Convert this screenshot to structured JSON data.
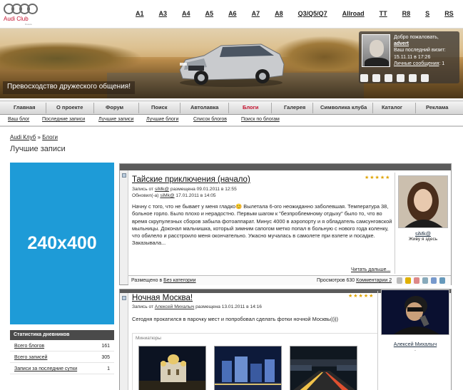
{
  "logo": {
    "club": "Audi Club",
    "sub": "Russia"
  },
  "models": [
    "A1",
    "A3",
    "A4",
    "A5",
    "A6",
    "A7",
    "A8",
    "Q3/Q5/Q7",
    "Allroad",
    "TT",
    "R8",
    "S",
    "RS"
  ],
  "banner": {
    "tagline": "Превосходство дружеского общения!"
  },
  "user": {
    "welcome": "Добро пожаловать,",
    "name": "advert",
    "last_visit_label": "Ваш последний визит:",
    "last_visit": "15.11.11 в 17:26",
    "messages_label": "Личные сообщения",
    "messages_count": ": 1",
    "icons": [
      "profile-icon",
      "pages-icon",
      "book-icon",
      "screen-icon",
      "settings-icon",
      "exit-icon"
    ]
  },
  "nav": {
    "main": [
      "Главная",
      "О проекте",
      "Форум",
      "Поиск",
      "Автолавка",
      "Блоги",
      "Галерея",
      "Символика клуба",
      "Каталог",
      "Реклама"
    ],
    "sub": [
      "Ваш блог",
      "Последние записи",
      "Лучшие записи",
      "Лучшие блоги",
      "Список блогов",
      "Поиск по блогам"
    ]
  },
  "breadcrumb": {
    "root": "Audi Клуб",
    "sep": "»",
    "section": "Блоги"
  },
  "page_title": "Лучшие записи",
  "ad": {
    "label": "240x400"
  },
  "stats": {
    "title": "Статистика дневников",
    "rows": [
      {
        "label": "Всего блогов",
        "value": "161"
      },
      {
        "label": "Всего записей",
        "value": "305"
      },
      {
        "label": "Записи за последние сутки",
        "value": "1"
      }
    ]
  },
  "posts": [
    {
      "title": "Тайские приключения (начало)",
      "stars": "★★★★★",
      "meta_line1_pre": "Запись от ",
      "meta_line1_user": "siMk@",
      "meta_line1_post": " размещена 09.01.2011 в 12:55",
      "meta_line2_pre": "Обновил(-а) ",
      "meta_line2_user": "siMk@",
      "meta_line2_post": " 17.01.2011 в 14:05",
      "body": "Начну с того, что не бывает у меня гладко😊 Вылетала 6-ого неожиданно заболевшая. Температура 38, больное горло. Было плохо и нерадостно. Первым шагом к \"безпроблемному отдыху\" было то, что во время скрупулезных сборов забыла фотоаппарат. Минус 4000 в аэропорту и я обладатель самсунговской мыльницы. Доконал мальчишка, который зимним сапогом метко попал в больную с нового года коленку, что обилело и расстроило меня окончательно. Ужасно мучалась в самолете при взлете и посадке. Заказывала...",
      "read_more": "Читать дальше...",
      "footer_placed": "Размещено в ",
      "footer_category": "Без категории",
      "footer_views": "Просмотров 630 ",
      "footer_comments": "Комментарии 2",
      "author_name": "siMk@",
      "author_status": "Живу я здесь"
    },
    {
      "title": "Ночная Москва!",
      "stars": "★★★★★",
      "meta_pre": "Запись от ",
      "meta_user": "Алексей Михалыч",
      "meta_post": " размещена 13.01.2011 в 14:16",
      "body": "Сегодня прокатился в парочку мест и попробовал сделать фотки ночной Москвы))))",
      "thumbs_label": "Миниатюры",
      "author_name": "Алексей Михалыч",
      "author_status": "."
    }
  ],
  "colors": {
    "accent": "#c4122f",
    "ad": "#1e9bd7",
    "stars": "#e0a400"
  }
}
